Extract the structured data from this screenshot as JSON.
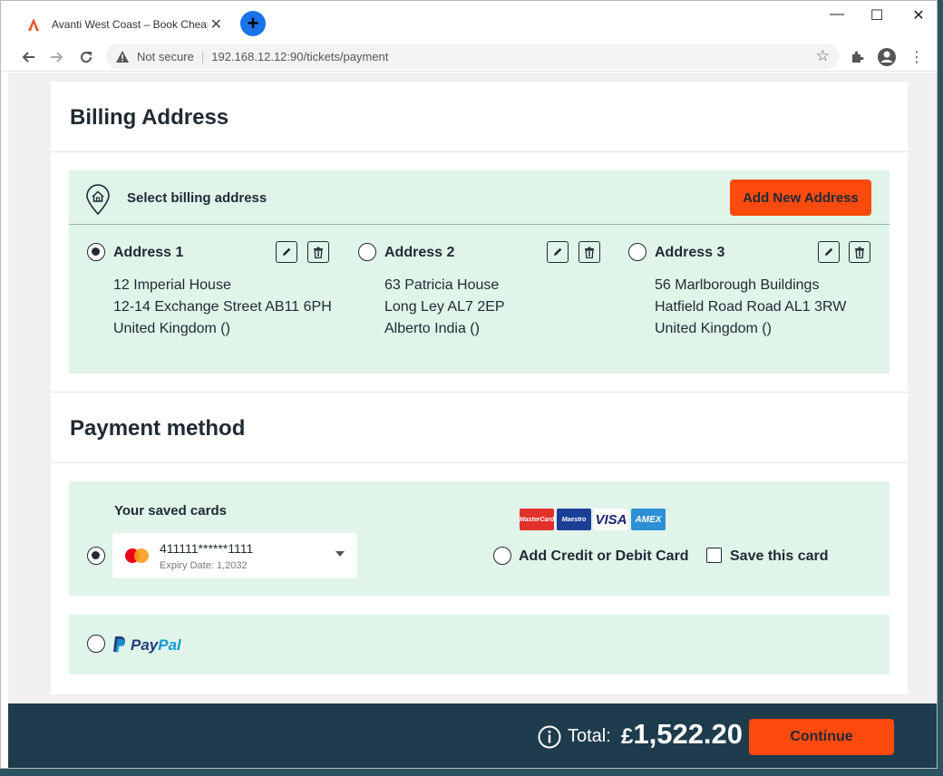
{
  "browser": {
    "tab_title": "Avanti West Coast – Book Cheap",
    "new_tab_label": "+",
    "security_label": "Not secure",
    "url": "192.168.12.12:90/tickets/payment"
  },
  "billing": {
    "title": "Billing Address",
    "select_label": "Select billing address",
    "add_button": "Add New Address",
    "addresses": [
      {
        "name": "Address 1",
        "line1": "12 Imperial House",
        "line2": "12-14 Exchange Street AB11 6PH",
        "line3": "United Kingdom ()",
        "selected": true
      },
      {
        "name": "Address 2",
        "line1": "63 Patricia House",
        "line2": "Long Ley AL7 2EP",
        "line3": "Alberto India ()",
        "selected": false
      },
      {
        "name": "Address 3",
        "line1": "56 Marlborough Buildings",
        "line2": "Hatfield Road Road AL1 3RW",
        "line3": "United Kingdom ()",
        "selected": false
      }
    ]
  },
  "payment": {
    "title": "Payment method",
    "saved_cards_label": "Your saved cards",
    "saved_card": {
      "number": "411111******1111",
      "expiry": "Expiry Date: 1,2032"
    },
    "card_logos": [
      "MasterCard",
      "Maestro",
      "VISA",
      "AMEX"
    ],
    "add_card_label": "Add Credit or Debit Card",
    "save_card_label": "Save this card",
    "paypal": {
      "part1": "Pay",
      "part2": "Pal"
    }
  },
  "footer": {
    "total_label": "Total:",
    "currency": "£",
    "total_value": "1,522.20",
    "continue_label": "Continue"
  },
  "colors": {
    "accent": "#ff4a0d",
    "panel": "#e0f4e9",
    "footer": "#1e3c4c"
  }
}
